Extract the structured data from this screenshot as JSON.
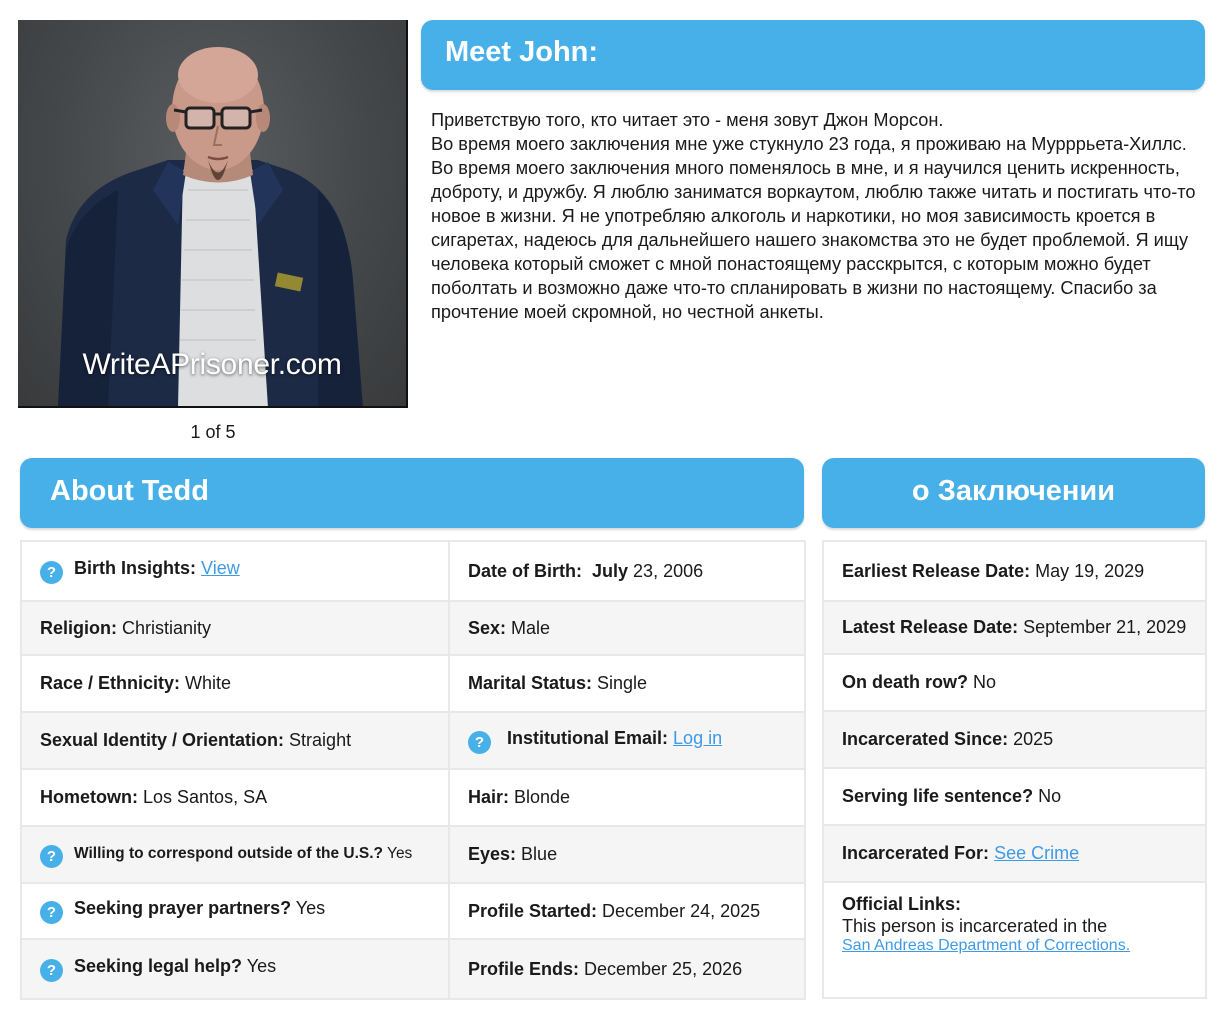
{
  "photo": {
    "watermark": "WriteAPrisoner.com",
    "counter": "1 of 5"
  },
  "meet": {
    "title": "Meet John:",
    "bio": [
      "Приветствую того, кто читает это  - меня зовут Джон Морсон.",
      "Во время моего заключения мне уже стукнуло 23 года, я проживаю на Мурррьета-Хиллс. Во время моего заключения много поменялось в мне, и я научился ценить искренность, доброту, и дружбу. Я люблю заниматся воркаутом, люблю также читать и постигать что-то новое в жизни. Я не употребляю алкоголь и наркотики, но моя зависимость кроется в сигаретах, надеюсь для дальнейшего нашего знакомства это не будет проблемой. Я ищу человека который сможет с мной понастоящему расскрытся, с которым можно будет поболтать и возможно даже что-то спланировать в жизни по настоящему. Спасибо за прочтение моей скромной, но честной анкеты."
    ]
  },
  "about": {
    "title": "About Tedd",
    "rows": [
      {
        "left": {
          "label": "Birth Insights:",
          "link": "View"
        },
        "right": {
          "label": "Date of Birth:",
          "label_month": "July",
          "value": " 23, 2006"
        }
      },
      {
        "left": {
          "label": "Religion:",
          "value": " Christianity"
        },
        "right": {
          "label": "Sex:",
          "value": " Male"
        }
      },
      {
        "left": {
          "label": "Race / Ethnicity:",
          "value": " White"
        },
        "right": {
          "label": "Marital Status:",
          "value": " Single"
        }
      },
      {
        "left": {
          "label": "Sexual Identity / Orientation:",
          "value": " Straight"
        },
        "right": {
          "label": "Institutional Email:",
          "link": "Log in"
        }
      },
      {
        "left": {
          "label": "Hometown:",
          "value": " Los Santos, SA"
        },
        "right": {
          "label": "Hair:",
          "value": " Blonde"
        }
      },
      {
        "left": {
          "label": "Willing to correspond outside of the U.S.?",
          "value": " Yes"
        },
        "right": {
          "label": "Eyes:",
          "value": " Blue"
        }
      },
      {
        "left": {
          "label": "Seeking prayer partners?",
          "value": " Yes"
        },
        "right": {
          "label": "Profile Started:",
          "value": " December 24, 2025"
        }
      },
      {
        "left": {
          "label": "Seeking legal help?",
          "value": " Yes"
        },
        "right": {
          "label": "Profile Ends:",
          "value": " December 25, 2026"
        }
      }
    ]
  },
  "incarceration": {
    "title": "о Заключении",
    "rows": [
      {
        "label": "Earliest Release Date:",
        "value": " May 19, 2029"
      },
      {
        "label": "Latest Release Date:",
        "value": " September 21, 2029"
      },
      {
        "label": "On death row?",
        "value": " No"
      },
      {
        "label": "Incarcerated Since:",
        "value": " 2025"
      },
      {
        "label": "Serving life sentence?",
        "value": " No"
      },
      {
        "label": "Incarcerated For:",
        "link": "See Crime"
      }
    ],
    "official": {
      "label": "Official Links:",
      "text": "This person is incarcerated in the",
      "link": "San Andreas Department of Corrections."
    }
  },
  "icons": {
    "help": "?"
  },
  "colors": {
    "header_blue": "#48b0e8",
    "link_blue": "#3f9ae6"
  }
}
